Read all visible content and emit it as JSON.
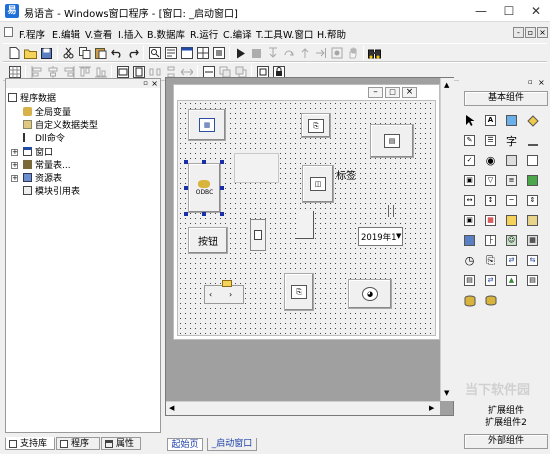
{
  "window": {
    "app_logo_glyph": "易",
    "title": "易语言 - Windows窗口程序 - [窗口: _启动窗口]"
  },
  "menu": [
    {
      "label": "F.程序"
    },
    {
      "label": "E.编辑"
    },
    {
      "label": "V.查看"
    },
    {
      "label": "I.插入"
    },
    {
      "label": "B.数据库"
    },
    {
      "label": "R.运行"
    },
    {
      "label": "C.编译"
    },
    {
      "label": "T.工具"
    },
    {
      "label": "W.窗口"
    },
    {
      "label": "H.帮助"
    }
  ],
  "tree": {
    "root": "程序数据",
    "items": [
      "全局变量",
      "自定义数据类型",
      "Dll命令",
      "窗口",
      "常量表...",
      "资源表",
      "模块引用表"
    ]
  },
  "left_tabs": [
    "支持库",
    "程序",
    "属性"
  ],
  "form": {
    "label_text": "标签",
    "button_text": "按钮",
    "date_value": "2019年1",
    "odbc_text": "ODBC"
  },
  "design_tabs": [
    "起始页",
    "_启动窗口"
  ],
  "palette": {
    "header": "基本组件",
    "ext1": "扩展组件",
    "ext2": "扩展组件2",
    "external": "外部组件"
  },
  "watermark": "当下软件园"
}
